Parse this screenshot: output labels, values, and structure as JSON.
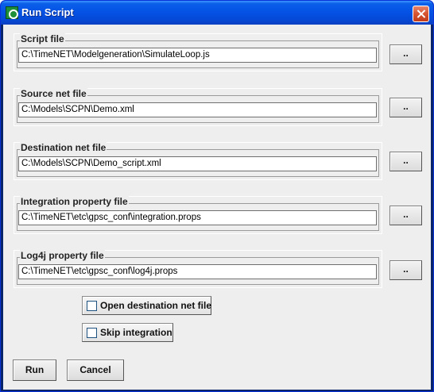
{
  "window": {
    "title": "Run Script",
    "app_icon": "timenet-app-icon",
    "close_icon": "close-icon"
  },
  "fields": [
    {
      "label": "Script file",
      "value": "C:\\TimeNET\\Modelgeneration\\SimulateLoop.js",
      "browse_label": ".."
    },
    {
      "label": "Source net file",
      "value": "C:\\Models\\SCPN\\Demo.xml",
      "browse_label": ".."
    },
    {
      "label": "Destination net file",
      "value": "C:\\Models\\SCPN\\Demo_script.xml",
      "browse_label": ".."
    },
    {
      "label": "Integration property file",
      "value": "C:\\TimeNET\\etc\\gpsc_conf\\integration.props",
      "browse_label": ".."
    },
    {
      "label": "Log4j property file",
      "value": "C:\\TimeNET\\etc\\gpsc_conf\\log4j.props",
      "browse_label": ".."
    }
  ],
  "options": {
    "open_destination": {
      "label": "Open destination net file",
      "checked": false
    },
    "skip_integration": {
      "label": "Skip integration",
      "checked": false
    }
  },
  "actions": {
    "run_label": "Run",
    "cancel_label": "Cancel"
  },
  "colors": {
    "titlebar": "#0553e6",
    "client_background": "#eeeeee",
    "close_button": "#d65430"
  }
}
